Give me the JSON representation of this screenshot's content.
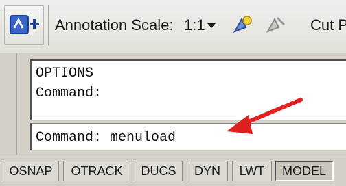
{
  "toolbar": {
    "left_icon": "ucs-add-icon",
    "annotation_label": "Annotation Scale:",
    "scale_value": "1:1",
    "icon_a": "annotation-visibility-icon",
    "icon_b": "auto-scale-icon",
    "cut_label": "Cut P"
  },
  "command": {
    "history": [
      "OPTIONS",
      "Command:"
    ],
    "current": "Command: menuload"
  },
  "status": {
    "buttons": [
      "OSNAP",
      "OTRACK",
      "DUCS",
      "DYN",
      "LWT",
      "MODEL"
    ]
  },
  "colors": {
    "arrow": "#e02020",
    "background": "#d4d0c8"
  }
}
